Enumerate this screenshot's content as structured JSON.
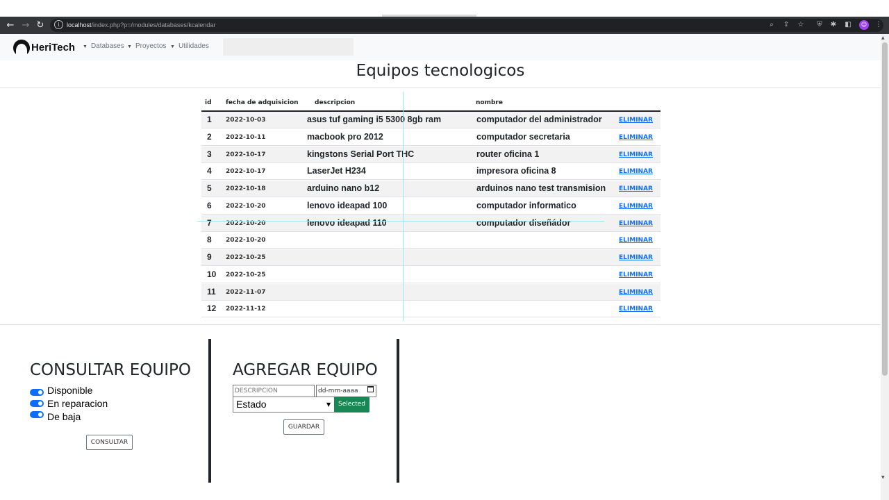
{
  "browser": {
    "url_host": "localhost",
    "url_path": "/index.php?p=/modules/databases/kcalendar"
  },
  "navbar": {
    "brand": "HeriTech",
    "menus": [
      "Databases",
      "Proyectos",
      "Utilidades"
    ]
  },
  "page": {
    "title": "Equipos tecnologicos"
  },
  "table": {
    "headers": [
      "id",
      "fecha de adquisicion",
      "descripcion",
      "nombre"
    ],
    "delete_label": "ELIMINAR",
    "rows": [
      {
        "id": "1",
        "date": "2022-10-03",
        "desc": "asus tuf gaming i5 5300 8gb ram",
        "name": "computador del administrador"
      },
      {
        "id": "2",
        "date": "2022-10-11",
        "desc": "macbook pro 2012",
        "name": "computador secretaria"
      },
      {
        "id": "3",
        "date": "2022-10-17",
        "desc": "kingstons Serial Port THC",
        "name": "router oficina 1"
      },
      {
        "id": "4",
        "date": "2022-10-17",
        "desc": "LaserJet H234",
        "name": "impresora oficina 8"
      },
      {
        "id": "5",
        "date": "2022-10-18",
        "desc": "arduino nano b12",
        "name": "arduinos nano test transmision"
      },
      {
        "id": "6",
        "date": "2022-10-20",
        "desc": "lenovo ideapad 100",
        "name": "computador informatico"
      },
      {
        "id": "7",
        "date": "2022-10-20",
        "desc": "lenovo ideapad 110",
        "name": "computador diseñádor"
      },
      {
        "id": "8",
        "date": "2022-10-20",
        "desc": "",
        "name": ""
      },
      {
        "id": "9",
        "date": "2022-10-25",
        "desc": "",
        "name": ""
      },
      {
        "id": "10",
        "date": "2022-10-25",
        "desc": "",
        "name": ""
      },
      {
        "id": "11",
        "date": "2022-11-07",
        "desc": "",
        "name": ""
      },
      {
        "id": "12",
        "date": "2022-11-12",
        "desc": "",
        "name": ""
      }
    ]
  },
  "consultar": {
    "title": "CONSULTAR EQUIPO",
    "toggles": [
      "Disponible",
      "En reparacion",
      "De baja"
    ],
    "button": "CONSULTAR"
  },
  "agregar": {
    "title": "AGREGAR EQUIPO",
    "desc_placeholder": "DESCRIPCION",
    "date_placeholder": "dd-mm-aaaa",
    "select_value": "Estado",
    "selected_button": "Selected",
    "save_button": "GUARDAR"
  },
  "colors": {
    "link": "#0d6efd",
    "toggle": "#0d6efd",
    "success": "#198754"
  }
}
